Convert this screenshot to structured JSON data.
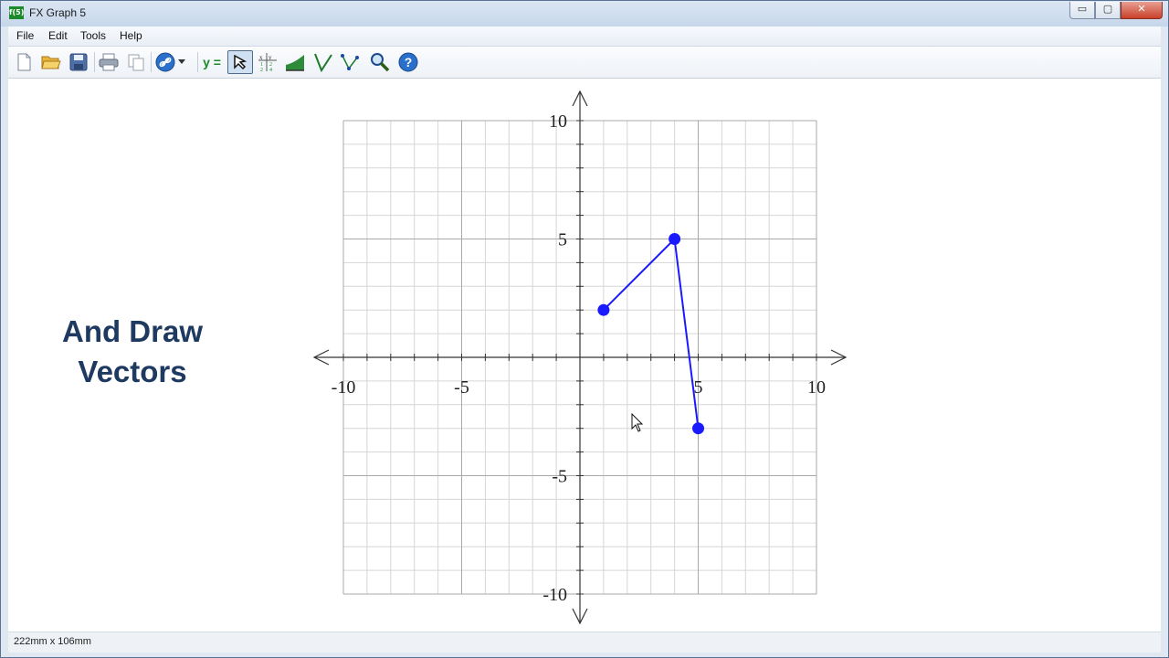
{
  "window": {
    "title": "FX Graph 5",
    "app_icon_text": "f(5)",
    "controls": {
      "minimize": "▭",
      "maximize": "▢",
      "close": "✕"
    }
  },
  "menu": [
    {
      "label": "File"
    },
    {
      "label": "Edit"
    },
    {
      "label": "Tools"
    },
    {
      "label": "Help"
    }
  ],
  "toolbar": {
    "items": [
      {
        "icon": "new-document-icon"
      },
      {
        "icon": "open-folder-icon"
      },
      {
        "icon": "save-icon"
      },
      {
        "icon": "print-icon"
      },
      {
        "icon": "copy-icon"
      },
      {
        "icon": "link-icon"
      },
      {
        "icon": "dropdown-arrow-icon"
      },
      {
        "icon": "function-editor-icon",
        "label": "y ="
      },
      {
        "icon": "select-pointer-icon",
        "active": true
      },
      {
        "icon": "table-of-values-icon"
      },
      {
        "icon": "area-under-curve-icon"
      },
      {
        "icon": "vector-tool-icon"
      },
      {
        "icon": "point-vector-tool-icon"
      },
      {
        "icon": "zoom-icon"
      },
      {
        "icon": "help-icon"
      }
    ],
    "accent": "#2a6fc9"
  },
  "slide_heading": {
    "line1": "And Draw",
    "line2": "Vectors",
    "color": "#1f3a60"
  },
  "status": {
    "text": "222mm x 106mm"
  },
  "chart_data": {
    "type": "line",
    "xlim": [
      -10,
      10
    ],
    "ylim": [
      -10,
      10
    ],
    "grid": true,
    "minor_step": 1,
    "major_step": 5,
    "x_tick_labels": [
      "-10",
      "-5",
      "5",
      "10"
    ],
    "y_tick_labels": [
      "10",
      "5",
      "-5",
      "-10"
    ],
    "series": [
      {
        "color": "#1a1aff",
        "points": [
          [
            1,
            2
          ],
          [
            4,
            5
          ],
          [
            5,
            -3
          ]
        ]
      }
    ]
  }
}
